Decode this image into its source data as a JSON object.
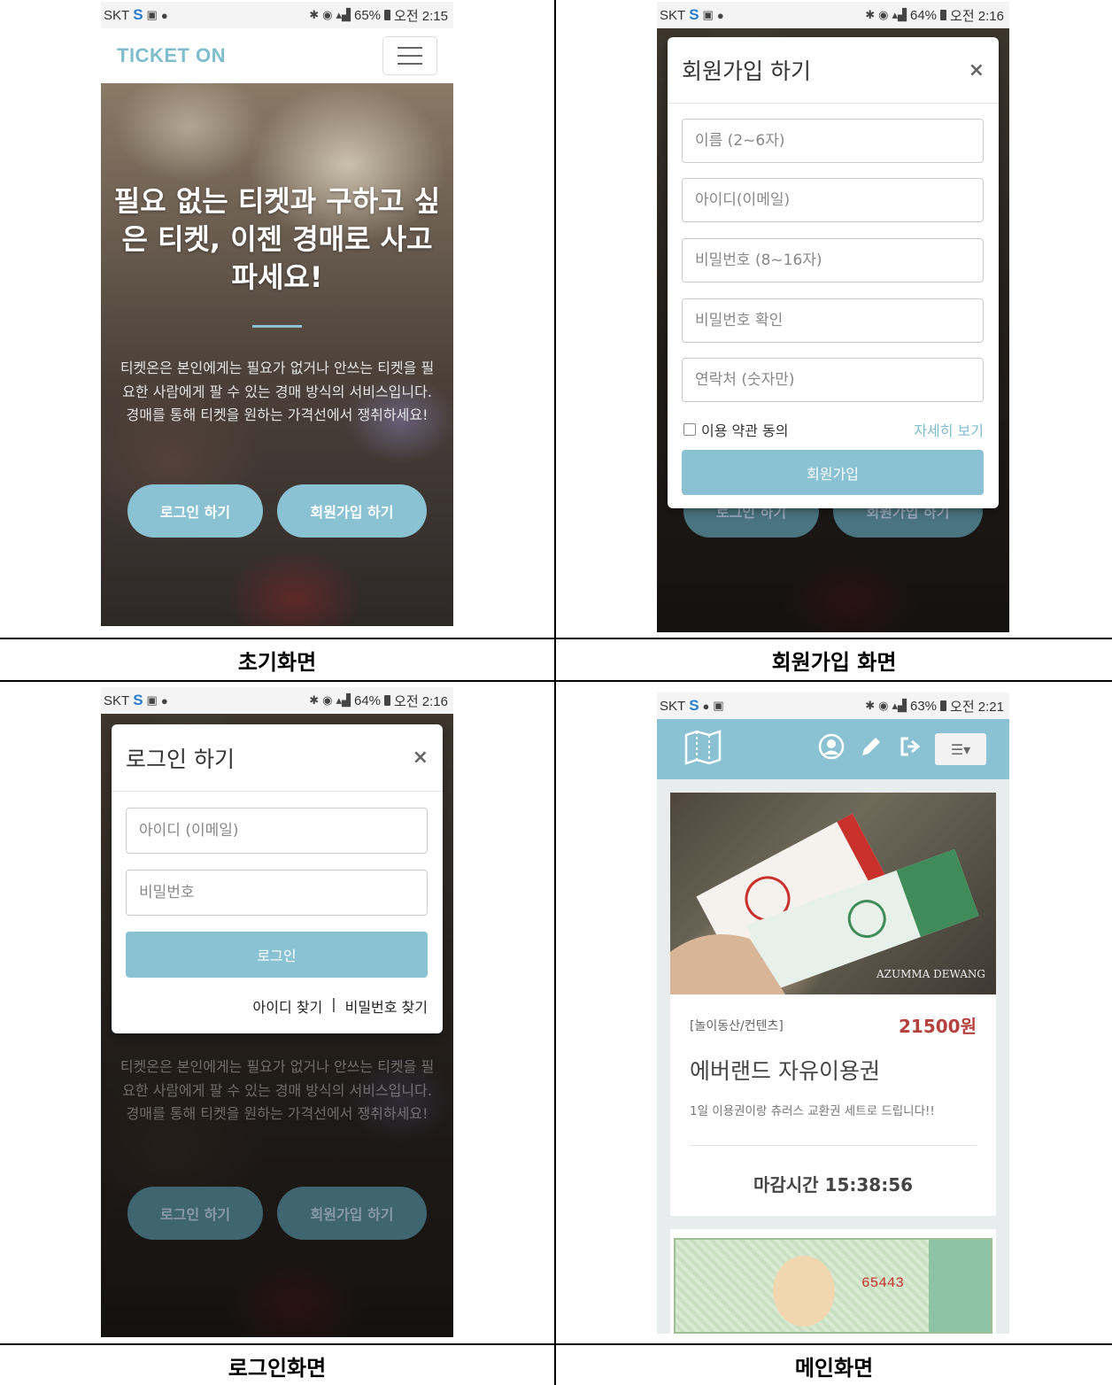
{
  "status": {
    "s1": {
      "carrier": "SKT",
      "battery": "65%",
      "time": "오전 2:15"
    },
    "s2": {
      "carrier": "SKT",
      "battery": "64%",
      "time": "오전 2:16"
    },
    "s3": {
      "carrier": "SKT",
      "battery": "64%",
      "time": "오전 2:16"
    },
    "s4": {
      "carrier": "SKT",
      "battery": "63%",
      "time": "오전 2:21"
    }
  },
  "captions": {
    "initial": "초기화면",
    "signup": "회원가입 화면",
    "login": "로그인화면",
    "main": "메인화면"
  },
  "landing": {
    "brand": "TICKET ON",
    "hero_title": "필요 없는 티켓과 구하고 싶은 티켓, 이젠 경매로 사고파세요!",
    "hero_desc": "티켓온은 본인에게는 필요가 없거나 안쓰는 티켓을 필요한 사람에게 팔 수 있는 경매 방식의 서비스입니다. 경매를 통해 티켓을 원하는 가격선에서 쟁취하세요!",
    "login_button": "로그인 하기",
    "signup_button": "회원가입 하기"
  },
  "signup_modal": {
    "title": "회원가입 하기",
    "close": "×",
    "name_placeholder": "이름 (2~6자)",
    "id_placeholder": "아이디(이메일)",
    "password_placeholder": "비밀번호 (8~16자)",
    "password_confirm_placeholder": "비밀번호 확인",
    "phone_placeholder": "연락처 (숫자만)",
    "agree_label": "이용 약관 동의",
    "more_link": "자세히 보기",
    "submit": "회원가입"
  },
  "login_modal": {
    "title": "로그인 하기",
    "close": "×",
    "id_placeholder": "아이디 (이메일)",
    "password_placeholder": "비밀번호",
    "submit": "로그인",
    "find_id": "아이디 찾기",
    "separator": "|",
    "find_password": "비밀번호 찾기"
  },
  "main": {
    "menu_glyph": "☰▾",
    "product": {
      "category": "[놀이동산/컨텐츠]",
      "price": "21500원",
      "title": "에버랜드 자유이용권",
      "description": "1일 이용권이랑 츄러스 교환권 세트로 드립니다!!",
      "deadline": "마감시간 15:38:56",
      "image_text": "AZUMMA DEWANG"
    },
    "second_card_text": "65443"
  },
  "colors": {
    "accent": "#8ac2d3",
    "brand": "#7fbccc",
    "price": "#b5413f"
  },
  "icons": [
    "map-icon",
    "user-icon",
    "pencil-icon",
    "logout-icon",
    "list-icon"
  ]
}
